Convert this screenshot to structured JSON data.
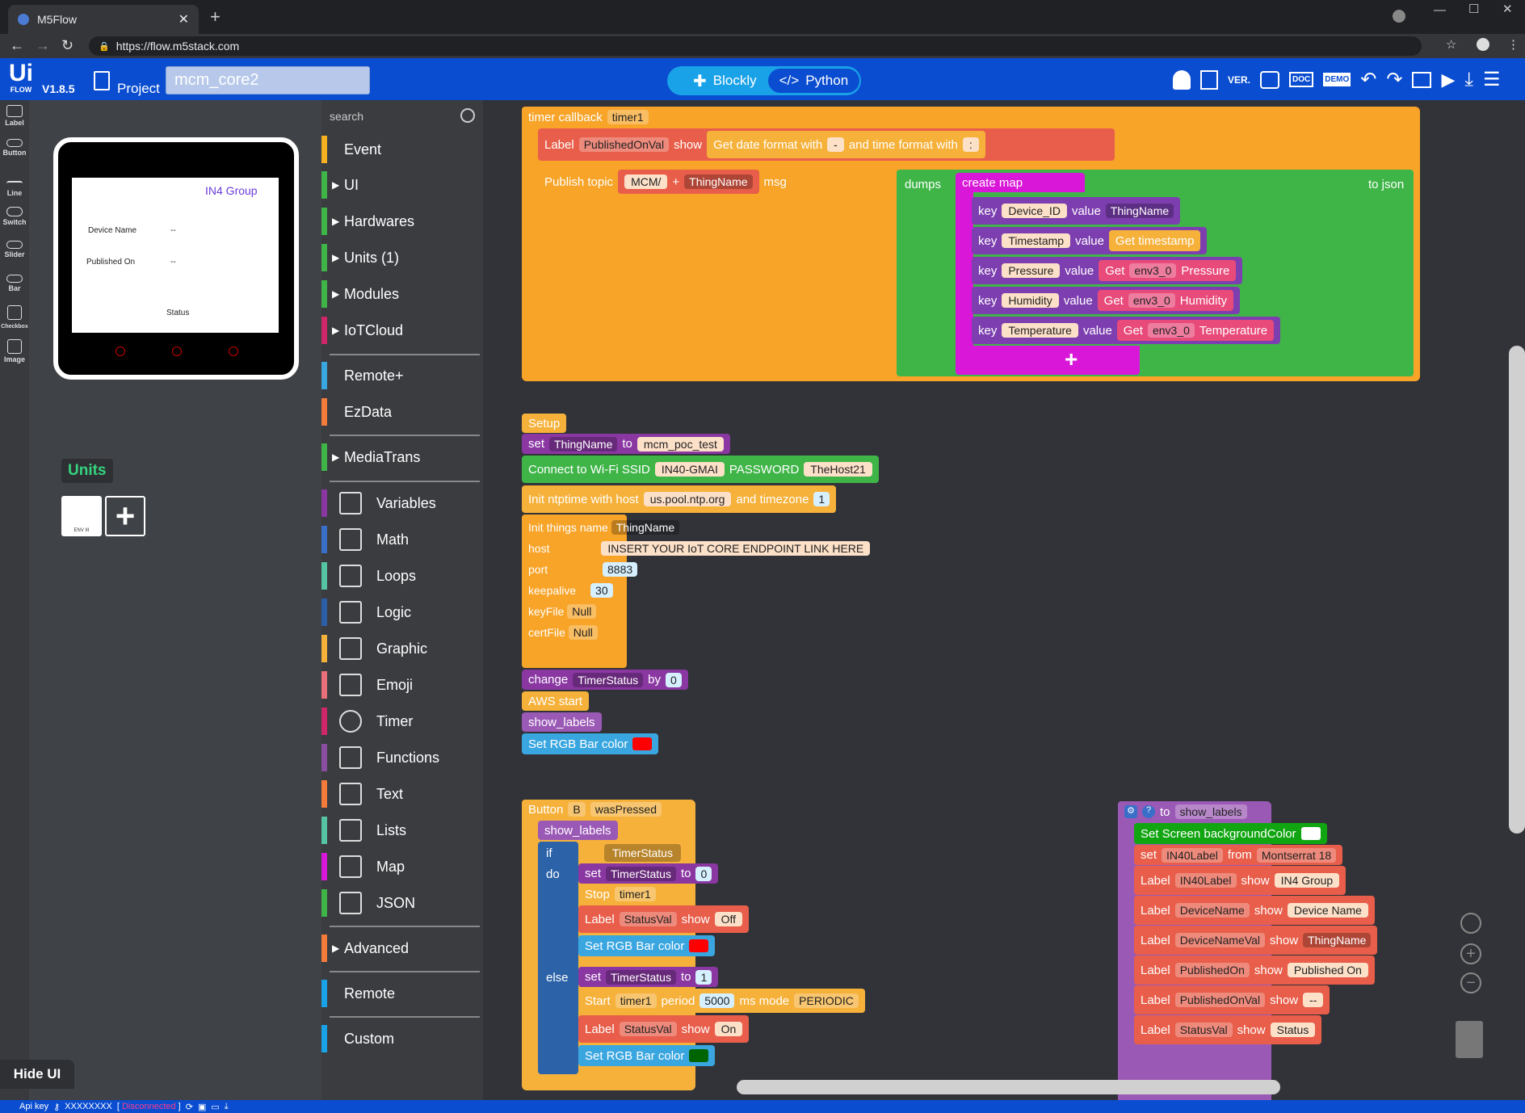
{
  "browser": {
    "tab_title": "M5Flow",
    "url": "https://flow.m5stack.com"
  },
  "header": {
    "logo_line1": "Ui",
    "logo_line2": "FLOW",
    "version": "V1.8.5",
    "project_label": "Project",
    "project_name": "mcm_core2",
    "mode_blockly": "Blockly",
    "mode_python": "Python",
    "ver_label": "VER.",
    "doc_label": "DOC",
    "demo_label": "DEMO"
  },
  "tools": [
    {
      "label": "Label"
    },
    {
      "label": "Button"
    },
    {
      "label": "Line"
    },
    {
      "label": "Switch"
    },
    {
      "label": "Slider"
    },
    {
      "label": "Bar"
    },
    {
      "label": "Checkbox"
    },
    {
      "label": "Image"
    }
  ],
  "device": {
    "group": "IN4 Group",
    "device_name_label": "Device Name",
    "device_name_val": "--",
    "published_on_label": "Published On",
    "published_on_val": "--",
    "status": "Status"
  },
  "units": {
    "title": "Units",
    "unit_name": "ENV III"
  },
  "hide_ui": "Hide UI",
  "search_placeholder": "search",
  "categories": {
    "event": "Event",
    "ui": "UI",
    "hardwares": "Hardwares",
    "units": "Units (1)",
    "modules": "Modules",
    "iotcloud": "IoTCloud",
    "remoteplus": "Remote+",
    "ezdata": "EzData",
    "mediatrans": "MediaTrans",
    "variables": "Variables",
    "math": "Math",
    "loops": "Loops",
    "logic": "Logic",
    "graphic": "Graphic",
    "emoji": "Emoji",
    "timer": "Timer",
    "functions": "Functions",
    "text": "Text",
    "lists": "Lists",
    "map": "Map",
    "json": "JSON",
    "advanced": "Advanced",
    "remote": "Remote",
    "custom": "Custom"
  },
  "blocks": {
    "timer_cb": "timer callback",
    "timer1": "timer1",
    "label": "Label",
    "published_on_val": "PublishedOnVal",
    "show": "show",
    "get_date_format": "Get date format with",
    "dash": "-",
    "and_time_format": "and time format with",
    "colon": ":",
    "publish_topic": "Publish topic",
    "mcm": "MCM/",
    "plus": "+",
    "thing_name": "ThingName",
    "msg": "msg",
    "dumps": "dumps",
    "create_map": "create map",
    "to_json": "to json",
    "key": "key",
    "value": "value",
    "device_id": "Device_ID",
    "timestamp": "Timestamp",
    "get_timestamp": "Get timestamp",
    "pressure": "Pressure",
    "humidity": "Humidity",
    "temperature": "Temperature",
    "get": "Get",
    "env": "env3_0",
    "setup": "Setup",
    "set": "set",
    "to": "to",
    "mcm_poc_test": "mcm_poc_test",
    "connect_wifi": "Connect to Wi-Fi SSID",
    "ssid": "IN40-GMAI",
    "password_lbl": "PASSWORD",
    "password": "TheHost21",
    "init_ntp": "Init ntptime with host",
    "ntp_host": "us.pool.ntp.org",
    "and_timezone": "and timezone",
    "tz": "1",
    "init_things": "Init things name",
    "host": "host",
    "host_val": "INSERT YOUR IoT CORE ENDPOINT LINK HERE",
    "port": "port",
    "port_val": "8883",
    "keepalive": "keepalive",
    "keepalive_val": "30",
    "keyfile": "keyFile",
    "certfile": "certFile",
    "null": "Null",
    "change": "change",
    "timer_status": "TimerStatus",
    "by": "by",
    "zero": "0",
    "one": "1",
    "aws_start": "AWS start",
    "show_labels": "show_labels",
    "set_rgb": "Set RGB Bar color",
    "button": "Button",
    "btn_b": "B",
    "was_pressed": "wasPressed",
    "if": "if",
    "do": "do",
    "else": "else",
    "stop": "Stop",
    "status_val": "StatusVal",
    "off": "Off",
    "on": "On",
    "start": "Start",
    "period": "period",
    "period_val": "5000",
    "ms_mode": "ms mode",
    "periodic": "PERIODIC",
    "to_show_labels": "to",
    "set_screen_bg": "Set Screen backgroundColor",
    "in40label": "IN40Label",
    "from": "from",
    "montserrat": "Montserrat 18",
    "in4_group": "IN4 Group",
    "device_name_var": "DeviceName",
    "device_name_str": "Device Name",
    "device_name_val_var": "DeviceNameVal",
    "published_on_var": "PublishedOn",
    "published_on_str": "Published On",
    "dashdash": "--",
    "status_str": "Status"
  },
  "status_bar": {
    "api_key_label": "Api key",
    "api_key": "XXXXXXXX",
    "state": "Disconnected"
  },
  "colors": {
    "header_blue": "#0a4dd1",
    "mode_blue": "#1aa2e8",
    "units_green": "#34d37e",
    "disconnected": "#ff3b8a"
  }
}
